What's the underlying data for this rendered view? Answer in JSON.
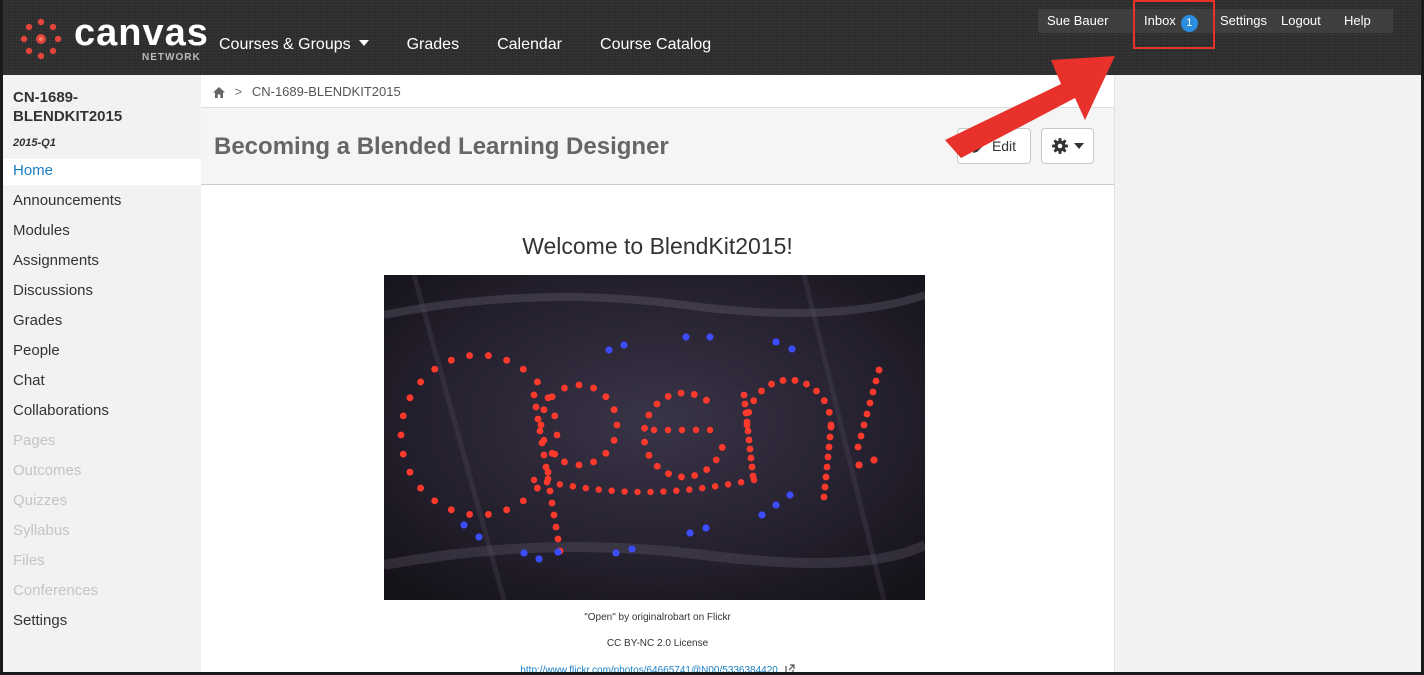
{
  "brand": {
    "name": "canvas",
    "sub": "NETWORK"
  },
  "nav": {
    "items": [
      {
        "label": "Courses & Groups",
        "has_caret": true
      },
      {
        "label": "Grades"
      },
      {
        "label": "Calendar"
      },
      {
        "label": "Course Catalog"
      }
    ]
  },
  "user_nav": {
    "user": "Sue Bauer",
    "inbox": "Inbox",
    "inbox_count": "1",
    "settings": "Settings",
    "logout": "Logout",
    "help": "Help"
  },
  "course": {
    "name": "CN-1689-BLENDKIT2015",
    "name_line1": "CN-1689-",
    "name_line2": "BLENDKIT2015",
    "term": "2015-Q1"
  },
  "sidebar": {
    "items": [
      {
        "label": "Home",
        "state": "active"
      },
      {
        "label": "Announcements",
        "state": "enabled"
      },
      {
        "label": "Modules",
        "state": "enabled"
      },
      {
        "label": "Assignments",
        "state": "enabled"
      },
      {
        "label": "Discussions",
        "state": "enabled"
      },
      {
        "label": "Grades",
        "state": "enabled"
      },
      {
        "label": "People",
        "state": "enabled"
      },
      {
        "label": "Chat",
        "state": "enabled"
      },
      {
        "label": "Collaborations",
        "state": "enabled"
      },
      {
        "label": "Pages",
        "state": "disabled"
      },
      {
        "label": "Outcomes",
        "state": "disabled"
      },
      {
        "label": "Quizzes",
        "state": "disabled"
      },
      {
        "label": "Syllabus",
        "state": "disabled"
      },
      {
        "label": "Files",
        "state": "disabled"
      },
      {
        "label": "Conferences",
        "state": "disabled"
      },
      {
        "label": "Settings",
        "state": "enabled"
      }
    ]
  },
  "breadcrumb": {
    "current": "CN-1689-BLENDKIT2015"
  },
  "page": {
    "title": "Becoming a Blended Learning Designer",
    "edit_label": "Edit",
    "welcome": "Welcome to BlendKit2015!",
    "caption_1": "\"Open\" by originalrobart on Flickr",
    "caption_2": "CC BY-NC 2.0 License",
    "caption_link": "http://www.flickr.com/photos/64665741@N00/5336384420"
  },
  "colors": {
    "header_bg": "#2c2c2c",
    "accent_link": "#1a7fc1",
    "badge": "#2a8de0",
    "annotation_red": "#e8312a"
  }
}
